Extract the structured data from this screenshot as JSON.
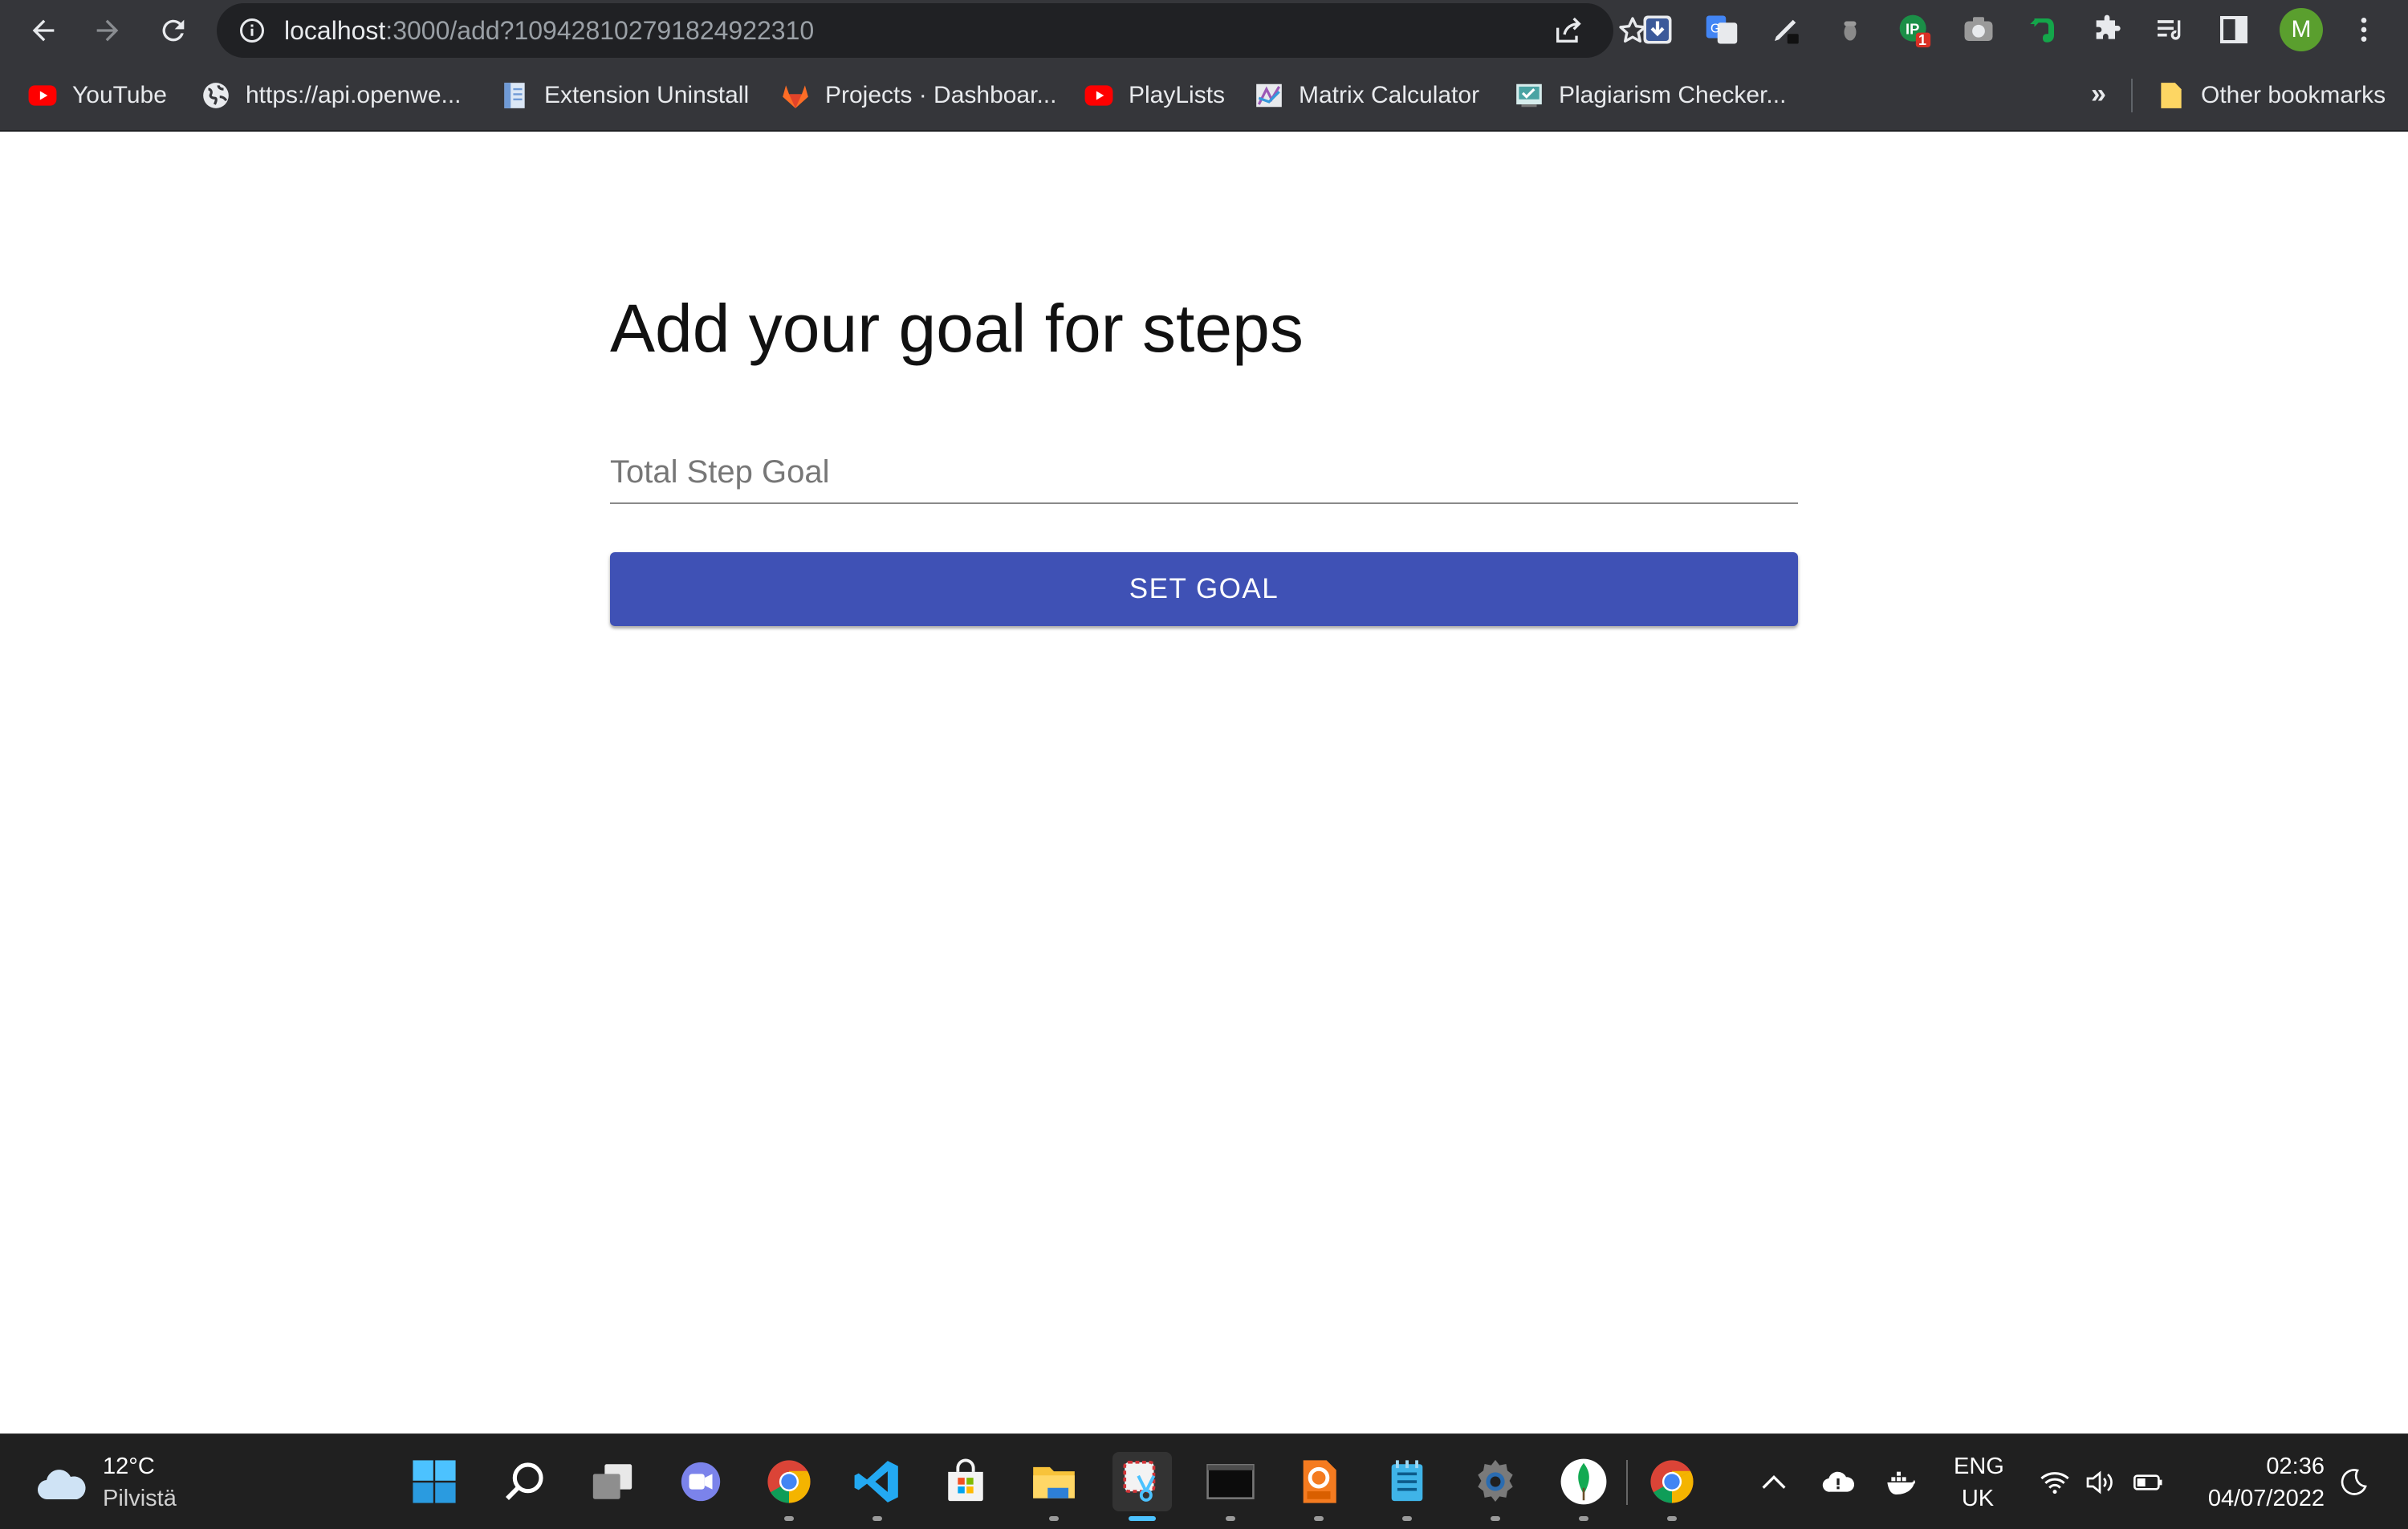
{
  "browser": {
    "url_host": "localhost",
    "url_rest": ":3000/add?109428102791824922310",
    "avatar_initial": "M",
    "extension_badge": "1"
  },
  "bookmarks": {
    "items": [
      {
        "label": "YouTube",
        "icon": "youtube-icon"
      },
      {
        "label": "https://api.openwe...",
        "icon": "globe-icon"
      },
      {
        "label": "Extension Uninstall",
        "icon": "document-icon"
      },
      {
        "label": "Projects · Dashboar...",
        "icon": "gitlab-icon"
      },
      {
        "label": "PlayLists",
        "icon": "youtube-icon"
      },
      {
        "label": "Matrix Calculator",
        "icon": "matrix-icon"
      },
      {
        "label": "Plagiarism Checker...",
        "icon": "checker-icon"
      }
    ],
    "overflow": "»",
    "other": "Other bookmarks"
  },
  "page": {
    "title": "Add your goal for steps",
    "input_placeholder": "Total Step Goal",
    "button_label": "SET GOAL",
    "accent_color": "#3f51b5"
  },
  "taskbar": {
    "weather_temp": "12°C",
    "weather_desc": "Pilvistä",
    "lang_top": "ENG",
    "lang_bottom": "UK",
    "time": "02:36",
    "date": "04/07/2022"
  }
}
